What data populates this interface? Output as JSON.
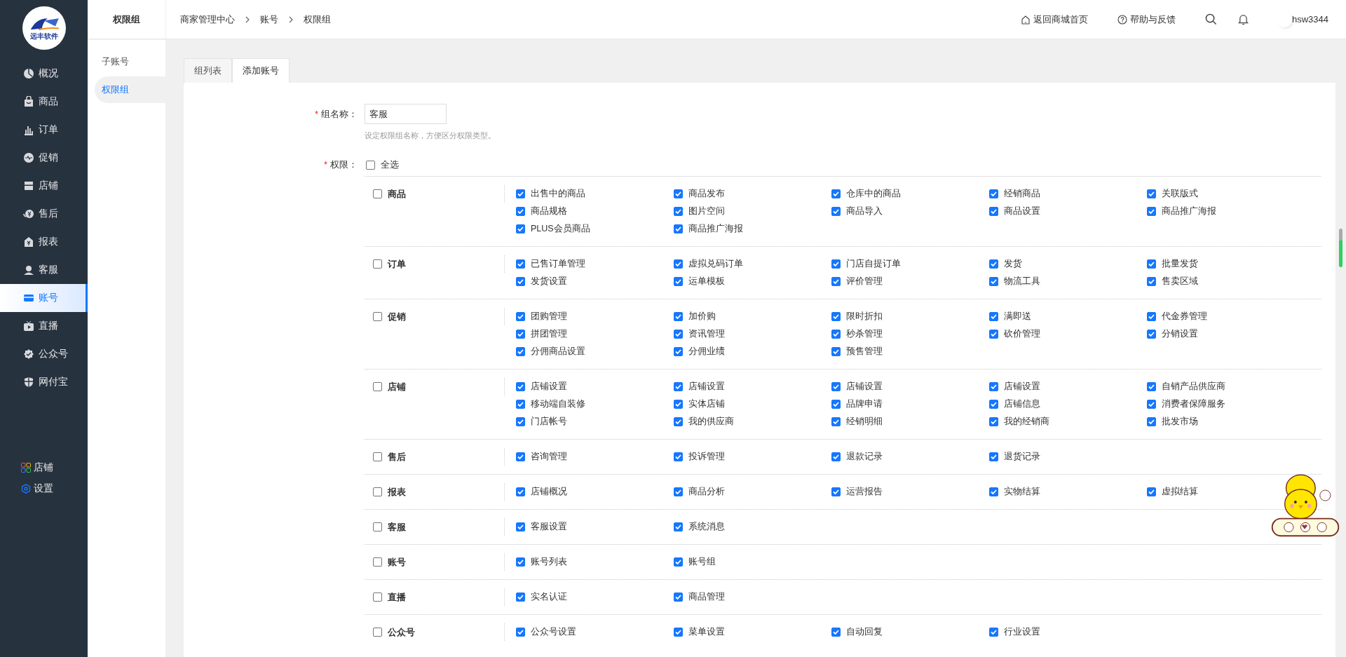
{
  "sidebar": {
    "logo_text": "远丰软件",
    "items": [
      {
        "label": "概况",
        "selected": false
      },
      {
        "label": "商品",
        "selected": false
      },
      {
        "label": "订单",
        "selected": false
      },
      {
        "label": "促销",
        "selected": false
      },
      {
        "label": "店铺",
        "selected": false
      },
      {
        "label": "售后",
        "selected": false
      },
      {
        "label": "报表",
        "selected": false
      },
      {
        "label": "客服",
        "selected": false
      },
      {
        "label": "账号",
        "selected": true
      },
      {
        "label": "直播",
        "selected": false
      },
      {
        "label": "公众号",
        "selected": false
      },
      {
        "label": "网付宝",
        "selected": false
      }
    ],
    "bottom_items": [
      {
        "label": "店铺"
      },
      {
        "label": "设置"
      }
    ]
  },
  "subnav": {
    "title": "权限组",
    "items": [
      {
        "label": "子账号",
        "selected": false
      },
      {
        "label": "权限组",
        "selected": true
      }
    ]
  },
  "breadcrumb": [
    "商家管理中心",
    "账号",
    "权限组"
  ],
  "header_links": [
    {
      "label": "返回商城首页"
    },
    {
      "label": "帮助与反馈"
    }
  ],
  "user": "hsw3344",
  "tabs": [
    {
      "label": "组列表",
      "selected": false
    },
    {
      "label": "添加账号",
      "selected": true
    }
  ],
  "form": {
    "name_field": {
      "mark": "*",
      "label": "组名称：",
      "value": "客服",
      "hint": "设定权限组名称，方便区分权限类型。"
    },
    "permissions_field": {
      "mark": "*",
      "label": "权限：",
      "select_all": {
        "label": "全选",
        "checked": false
      }
    }
  },
  "groups": [
    {
      "label": "商品",
      "checked": false,
      "items": [
        {
          "label": "出售中的商品",
          "checked": true
        },
        {
          "label": "商品发布",
          "checked": true
        },
        {
          "label": "仓库中的商品",
          "checked": true
        },
        {
          "label": "经销商品",
          "checked": true
        },
        {
          "label": "关联版式",
          "checked": true
        },
        {
          "label": "商品规格",
          "checked": true
        },
        {
          "label": "图片空间",
          "checked": true
        },
        {
          "label": "商品导入",
          "checked": true
        },
        {
          "label": "商品设置",
          "checked": true
        },
        {
          "label": "商品推广海报",
          "checked": true
        },
        {
          "label": "PLUS会员商品",
          "checked": true
        },
        {
          "label": "商品推广海报",
          "checked": true
        }
      ]
    },
    {
      "label": "订单",
      "checked": false,
      "items": [
        {
          "label": "已售订单管理",
          "checked": true
        },
        {
          "label": "虚拟兑码订单",
          "checked": true
        },
        {
          "label": "门店自提订单",
          "checked": true
        },
        {
          "label": "发货",
          "checked": true
        },
        {
          "label": "批量发货",
          "checked": true
        },
        {
          "label": "发货设置",
          "checked": true
        },
        {
          "label": "运单模板",
          "checked": true
        },
        {
          "label": "评价管理",
          "checked": true
        },
        {
          "label": "物流工具",
          "checked": true
        },
        {
          "label": "售卖区域",
          "checked": true
        }
      ]
    },
    {
      "label": "促销",
      "checked": false,
      "items": [
        {
          "label": "团购管理",
          "checked": true
        },
        {
          "label": "加价购",
          "checked": true
        },
        {
          "label": "限时折扣",
          "checked": true
        },
        {
          "label": "满即送",
          "checked": true
        },
        {
          "label": "代金券管理",
          "checked": true
        },
        {
          "label": "拼团管理",
          "checked": true
        },
        {
          "label": "资讯管理",
          "checked": true
        },
        {
          "label": "秒杀管理",
          "checked": true
        },
        {
          "label": "砍价管理",
          "checked": true
        },
        {
          "label": "分销设置",
          "checked": true
        },
        {
          "label": "分佣商品设置",
          "checked": true
        },
        {
          "label": "分佣业绩",
          "checked": true
        },
        {
          "label": "预售管理",
          "checked": true
        }
      ]
    },
    {
      "label": "店铺",
      "checked": false,
      "items": [
        {
          "label": "店铺设置",
          "checked": true
        },
        {
          "label": "店铺设置",
          "checked": true
        },
        {
          "label": "店铺设置",
          "checked": true
        },
        {
          "label": "店铺设置",
          "checked": true
        },
        {
          "label": "自销产品供应商",
          "checked": true
        },
        {
          "label": "移动端自装修",
          "checked": true
        },
        {
          "label": "实体店铺",
          "checked": true
        },
        {
          "label": "品牌申请",
          "checked": true
        },
        {
          "label": "店铺信息",
          "checked": true
        },
        {
          "label": "消费者保障服务",
          "checked": true
        },
        {
          "label": "门店帐号",
          "checked": true
        },
        {
          "label": "我的供应商",
          "checked": true
        },
        {
          "label": "经销明细",
          "checked": true
        },
        {
          "label": "我的经销商",
          "checked": true
        },
        {
          "label": "批发市场",
          "checked": true
        }
      ]
    },
    {
      "label": "售后",
      "checked": false,
      "items": [
        {
          "label": "咨询管理",
          "checked": true
        },
        {
          "label": "投诉管理",
          "checked": true
        },
        {
          "label": "退款记录",
          "checked": true
        },
        {
          "label": "退货记录",
          "checked": true
        }
      ]
    },
    {
      "label": "报表",
      "checked": false,
      "items": [
        {
          "label": "店铺概况",
          "checked": true
        },
        {
          "label": "商品分析",
          "checked": true
        },
        {
          "label": "运营报告",
          "checked": true
        },
        {
          "label": "实物结算",
          "checked": true
        },
        {
          "label": "虚拟结算",
          "checked": true
        }
      ]
    },
    {
      "label": "客服",
      "checked": false,
      "items": [
        {
          "label": "客服设置",
          "checked": true
        },
        {
          "label": "系统消息",
          "checked": true
        }
      ]
    },
    {
      "label": "账号",
      "checked": false,
      "items": [
        {
          "label": "账号列表",
          "checked": true
        },
        {
          "label": "账号组",
          "checked": true
        }
      ]
    },
    {
      "label": "直播",
      "checked": false,
      "items": [
        {
          "label": "实名认证",
          "checked": true
        },
        {
          "label": "商品管理",
          "checked": true
        }
      ]
    },
    {
      "label": "公众号",
      "checked": false,
      "items": [
        {
          "label": "公众号设置",
          "checked": true
        },
        {
          "label": "菜单设置",
          "checked": true
        },
        {
          "label": "自动回复",
          "checked": true
        },
        {
          "label": "行业设置",
          "checked": true
        }
      ]
    }
  ]
}
